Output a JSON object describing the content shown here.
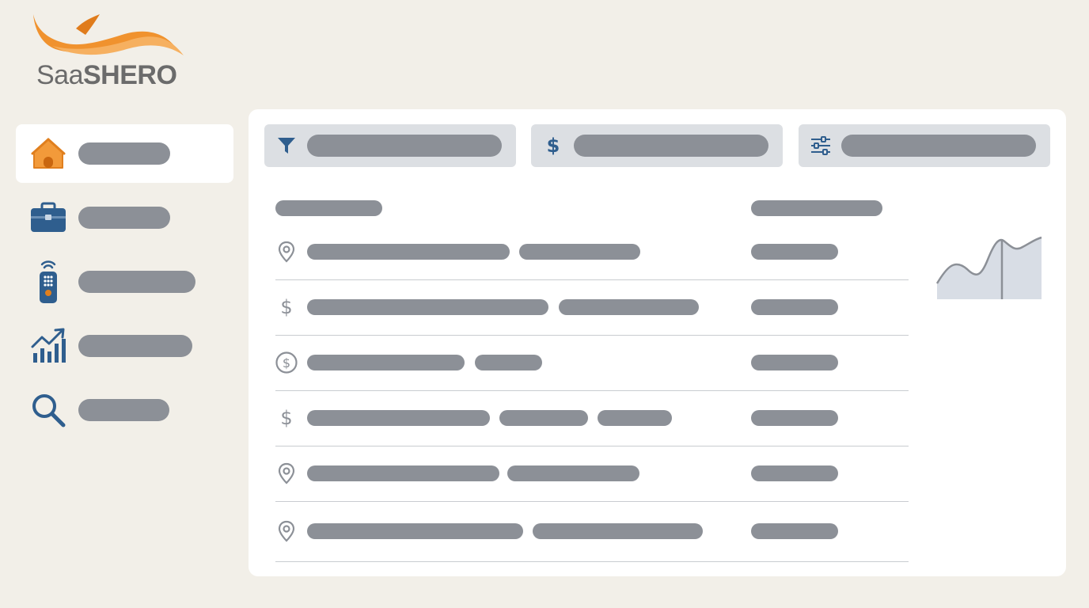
{
  "brand": {
    "name_light": "Saa",
    "name_bold": "SHERO",
    "swoosh_color": "#f0922e"
  },
  "sidebar": {
    "items": [
      {
        "icon": "home-icon",
        "active": true
      },
      {
        "icon": "briefcase-icon",
        "active": false
      },
      {
        "icon": "remote-control-icon",
        "active": false
      },
      {
        "icon": "growth-chart-icon",
        "active": false
      },
      {
        "icon": "search-icon",
        "active": false
      }
    ]
  },
  "filters": [
    {
      "icon": "funnel-icon"
    },
    {
      "icon": "dollar-icon",
      "glyph": "$"
    },
    {
      "icon": "sliders-icon"
    }
  ],
  "table": {
    "rows": [
      {
        "icon": "location-pin-icon"
      },
      {
        "icon": "dollar-sign-icon",
        "glyph": "$"
      },
      {
        "icon": "dollar-coin-icon",
        "glyph": "$"
      },
      {
        "icon": "dollar-sign-icon",
        "glyph": "$"
      },
      {
        "icon": "location-pin-icon"
      },
      {
        "icon": "location-pin-icon"
      }
    ]
  },
  "colors": {
    "accent_blue": "#2f5e8e",
    "accent_orange": "#f0922e",
    "placeholder_gray": "#8c9097",
    "background": "#f2efe8"
  }
}
